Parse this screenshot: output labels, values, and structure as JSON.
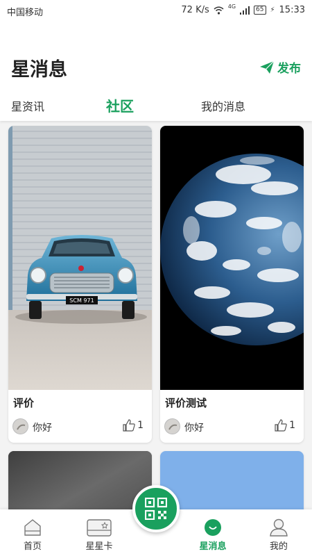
{
  "status_bar": {
    "carrier": "中国移动",
    "speed": "72 K/s",
    "network": "4G",
    "battery": "65",
    "time": "15:33"
  },
  "header": {
    "title": "星消息",
    "publish_label": "发布"
  },
  "tabs": [
    {
      "label": "星资讯",
      "active": false
    },
    {
      "label": "社区",
      "active": true
    },
    {
      "label": "我的消息",
      "active": false
    }
  ],
  "posts": [
    {
      "title": "评价",
      "author": "你好",
      "likes": "1",
      "image": "blue-vintage-car",
      "plate": "SCM 971"
    },
    {
      "title": "评价测试",
      "author": "你好",
      "likes": "1",
      "image": "earth-from-space"
    },
    {
      "image": "dark-cloudy-sky"
    },
    {
      "image": "light-blue"
    }
  ],
  "bottom_nav": [
    {
      "label": "首页",
      "icon": "home-icon",
      "active": false
    },
    {
      "label": "星星卡",
      "icon": "card-icon",
      "active": false
    },
    {
      "label": "",
      "icon": "qr-code-icon",
      "active": false
    },
    {
      "label": "星消息",
      "icon": "message-icon",
      "active": true
    },
    {
      "label": "我的",
      "icon": "profile-icon",
      "active": false
    }
  ],
  "colors": {
    "accent": "#1aa05e",
    "background": "#f3f3f3"
  }
}
